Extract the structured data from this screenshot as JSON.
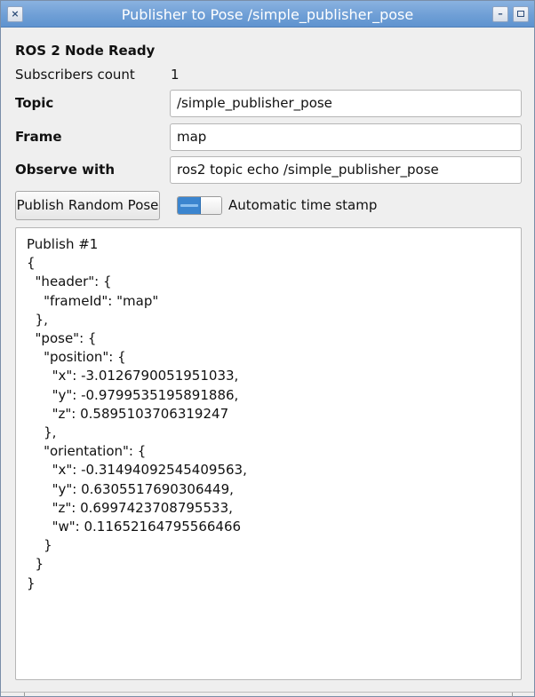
{
  "window": {
    "title": "Publisher to Pose /simple_publisher_pose",
    "close_glyph": "×",
    "minimize_glyph": "–"
  },
  "status": {
    "ready_text": "ROS 2 Node Ready",
    "subscribers_label": "Subscribers count",
    "subscribers_value": "1"
  },
  "form": {
    "topic_label": "Topic",
    "topic_value": "/simple_publisher_pose",
    "frame_label": "Frame",
    "frame_value": "map",
    "observe_label": "Observe with",
    "observe_value": "ros2 topic echo /simple_publisher_pose"
  },
  "controls": {
    "publish_button": "Publish Random Pose",
    "timestamp_toggle_label": "Automatic time stamp",
    "timestamp_toggle_on": true
  },
  "output": {
    "lines": [
      "Publish #1",
      "{",
      "  \"header\": {",
      "    \"frameId\": \"map\"",
      "  },",
      "  \"pose\": {",
      "    \"position\": {",
      "      \"x\": -3.0126790051951033,",
      "      \"y\": -0.9799535195891886,",
      "      \"z\": 0.5895103706319247",
      "    },",
      "    \"orientation\": {",
      "      \"x\": -0.31494092545409563,",
      "      \"y\": 0.6305517690306449,",
      "      \"z\": 0.6997423708795533,",
      "      \"w\": 0.11652164795566466",
      "    }",
      "  }",
      "}"
    ]
  },
  "colors": {
    "titlebar": "#6f9fd6",
    "toggle_on": "#3b85cf"
  }
}
